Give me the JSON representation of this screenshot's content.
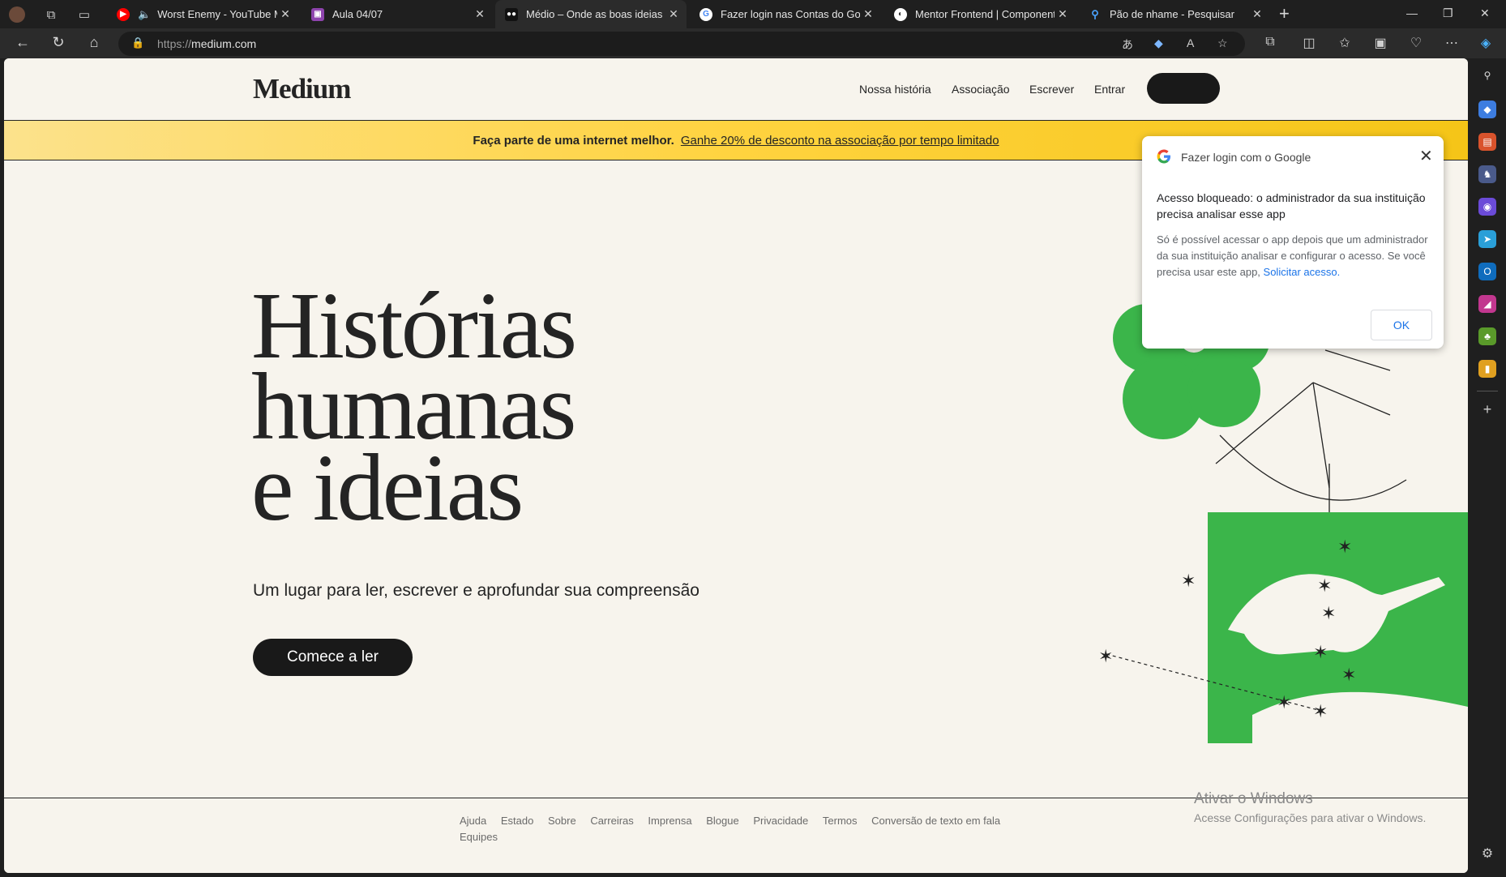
{
  "browser": {
    "tabs": [
      {
        "title": "Worst Enemy - YouTube Music",
        "favicon": "youtube-music-icon",
        "color": "#ff0000",
        "audio": true
      },
      {
        "title": "Aula 04/07",
        "favicon": "classroom-icon",
        "color": "#8e44ad"
      },
      {
        "title": "Médio – Onde as boas ideias te encontram",
        "favicon": "medium-icon",
        "color": "#111111",
        "active": true
      },
      {
        "title": "Fazer login nas Contas do Google",
        "favicon": "google-icon",
        "color": "#ffffff"
      },
      {
        "title": "Mentor Frontend | Componente",
        "favicon": "globe-icon",
        "color": "#ffffff"
      },
      {
        "title": "Pão de nhame - Pesquisar",
        "favicon": "search-icon",
        "color": "#2b2b2b"
      }
    ],
    "url_prefix": "https://",
    "url_host": "medium.com"
  },
  "medium": {
    "logo": "Medium",
    "nav": [
      "Nossa história",
      "Associação",
      "Escrever",
      "Entrar"
    ],
    "banner_bold": "Faça parte de uma internet melhor.",
    "banner_link": "Ganhe 20% de desconto na associação por tempo limitado",
    "hero_lines": [
      "Histórias",
      "humanas",
      "e ideias"
    ],
    "subtitle": "Um lugar para ler, escrever e aprofundar sua compreensão",
    "cta": "Comece a ler",
    "footer_links": [
      "Ajuda",
      "Estado",
      "Sobre",
      "Carreiras",
      "Imprensa",
      "Blogue",
      "Privacidade",
      "Termos",
      "Conversão de texto em fala",
      "Equipes"
    ]
  },
  "google_dialog": {
    "title": "Fazer login com o Google",
    "heading": "Acesso bloqueado: o administrador da sua instituição precisa analisar esse app",
    "body": "Só é possível acessar o app depois que um administrador da sua instituição analisar e configurar o acesso. Se você precisa usar este app,",
    "link": "Solicitar acesso.",
    "ok": "OK"
  },
  "watermark": {
    "line1": "Ativar o Windows",
    "line2": "Acesse Configurações para ativar o Windows."
  },
  "colors": {
    "accent_green": "#3bb54a",
    "banner_yellow": "#ffd33f",
    "page_bg": "#f7f4ed"
  }
}
